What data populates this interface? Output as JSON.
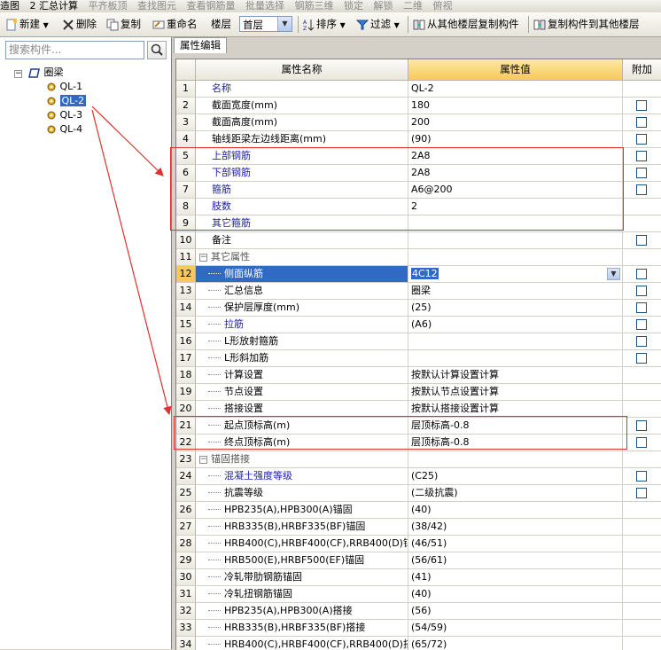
{
  "top_strip": [
    "造图",
    "2 汇总计算",
    "平齐板顶",
    "查找图元",
    "查看钢筋量",
    "批量选择",
    "钢筋三维",
    "锁定",
    "解锁",
    "二维",
    "俯视"
  ],
  "toolbar": {
    "new_label": "新建",
    "delete_label": "删除",
    "copy_label": "复制",
    "rename_label": "重命名",
    "floor_label": "楼层",
    "floor_value": "首层",
    "sort_label": "排序",
    "filter_label": "过滤",
    "copy_from_floor_label": "从其他楼层复制构件",
    "copy_to_floor_label": "复制构件到其他楼层"
  },
  "left": {
    "search_placeholder": "搜索构件...",
    "tree_root": "圈梁",
    "tree_items": [
      "QL-1",
      "QL-2",
      "QL-3",
      "QL-4"
    ],
    "selected": "QL-2"
  },
  "right": {
    "tab_label": "属性编辑",
    "headers": {
      "name": "属性名称",
      "value": "属性值",
      "add": "附加"
    },
    "rows": [
      {
        "n": "1",
        "name": "名称",
        "value": "QL-2",
        "style": "blue",
        "cb": false
      },
      {
        "n": "2",
        "name": "截面宽度(mm)",
        "value": "180",
        "style": "",
        "cb": true
      },
      {
        "n": "3",
        "name": "截面高度(mm)",
        "value": "200",
        "style": "",
        "cb": true
      },
      {
        "n": "4",
        "name": "轴线距梁左边线距离(mm)",
        "value": "(90)",
        "style": "",
        "cb": true
      },
      {
        "n": "5",
        "name": "上部钢筋",
        "value": "2A8",
        "style": "blue",
        "cb": true
      },
      {
        "n": "6",
        "name": "下部钢筋",
        "value": "2A8",
        "style": "blue",
        "cb": true
      },
      {
        "n": "7",
        "name": "箍筋",
        "value": "A6@200",
        "style": "blue",
        "cb": true
      },
      {
        "n": "8",
        "name": "肢数",
        "value": "2",
        "style": "blue",
        "cb": false
      },
      {
        "n": "9",
        "name": "其它箍筋",
        "value": "",
        "style": "blue",
        "cb": false
      },
      {
        "n": "10",
        "name": "备注",
        "value": "",
        "style": "",
        "cb": true
      },
      {
        "n": "11",
        "name": "其它属性",
        "value": "",
        "style": "group",
        "cb": false
      },
      {
        "n": "12",
        "name": "侧面纵筋",
        "value": "4C12",
        "style": "active",
        "cb": true
      },
      {
        "n": "13",
        "name": "汇总信息",
        "value": "圈梁",
        "style": "child",
        "cb": true
      },
      {
        "n": "14",
        "name": "保护层厚度(mm)",
        "value": "(25)",
        "style": "child",
        "cb": true
      },
      {
        "n": "15",
        "name": "拉筋",
        "value": "(A6)",
        "style": "childblue",
        "cb": true
      },
      {
        "n": "16",
        "name": "L形放射箍筋",
        "value": "",
        "style": "child",
        "cb": true
      },
      {
        "n": "17",
        "name": "L形斜加筋",
        "value": "",
        "style": "child",
        "cb": true
      },
      {
        "n": "18",
        "name": "计算设置",
        "value": "按默认计算设置计算",
        "style": "child",
        "cb": false
      },
      {
        "n": "19",
        "name": "节点设置",
        "value": "按默认节点设置计算",
        "style": "child",
        "cb": false
      },
      {
        "n": "20",
        "name": "搭接设置",
        "value": "按默认搭接设置计算",
        "style": "child",
        "cb": false
      },
      {
        "n": "21",
        "name": "起点顶标高(m)",
        "value": "层顶标高-0.8",
        "style": "child",
        "cb": true
      },
      {
        "n": "22",
        "name": "终点顶标高(m)",
        "value": "层顶标高-0.8",
        "style": "child",
        "cb": true
      },
      {
        "n": "23",
        "name": "锚固搭接",
        "value": "",
        "style": "group",
        "cb": false
      },
      {
        "n": "24",
        "name": "混凝土强度等级",
        "value": "(C25)",
        "style": "childblue",
        "cb": true
      },
      {
        "n": "25",
        "name": "抗震等级",
        "value": "(二级抗震)",
        "style": "child",
        "cb": true
      },
      {
        "n": "26",
        "name": "HPB235(A),HPB300(A)锚固",
        "value": "(40)",
        "style": "child",
        "cb": false
      },
      {
        "n": "27",
        "name": "HRB335(B),HRBF335(BF)锚固",
        "value": "(38/42)",
        "style": "child",
        "cb": false
      },
      {
        "n": "28",
        "name": "HRB400(C),HRBF400(CF),RRB400(D)锚",
        "value": "(46/51)",
        "style": "child",
        "cb": false
      },
      {
        "n": "29",
        "name": "HRB500(E),HRBF500(EF)锚固",
        "value": "(56/61)",
        "style": "child",
        "cb": false
      },
      {
        "n": "30",
        "name": "冷轧带肋钢筋锚固",
        "value": "(41)",
        "style": "child",
        "cb": false
      },
      {
        "n": "31",
        "name": "冷轧扭钢筋锚固",
        "value": "(40)",
        "style": "child",
        "cb": false
      },
      {
        "n": "32",
        "name": "HPB235(A),HPB300(A)搭接",
        "value": "(56)",
        "style": "child",
        "cb": false
      },
      {
        "n": "33",
        "name": "HRB335(B),HRBF335(BF)搭接",
        "value": "(54/59)",
        "style": "child",
        "cb": false
      },
      {
        "n": "34",
        "name": "HRB400(C),HRBF400(CF),RRB400(D)搭",
        "value": "(65/72)",
        "style": "child",
        "cb": false
      }
    ]
  },
  "colors": {
    "annotation": "#e03030",
    "selection": "#316ac5",
    "header_value": "#f8c95a",
    "blue_text": "#1c1cb0"
  }
}
